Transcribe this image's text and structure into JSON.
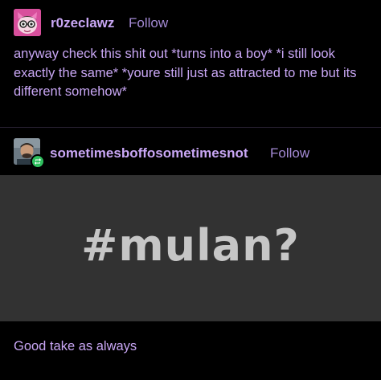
{
  "post1": {
    "username": "r0zeclawz",
    "follow_label": "Follow",
    "text": "anyway check this shit out *turns into a boy* *i still look exactly the same* *youre still just as attracted to me but its different somehow*"
  },
  "post2": {
    "username": "sometimesboffosometimesnot",
    "follow_label": "Follow",
    "image_text": "#mulan?",
    "caption": "Good take as always"
  },
  "colors": {
    "background": "#000000",
    "text_purple": "#c9a7f5",
    "follow_purple": "#a58bd6",
    "image_bg": "#323232",
    "image_text": "#c6c6c6",
    "reblog_green": "#2fbf5e"
  },
  "icons": {
    "post1_avatar": "cartoon-cat-avatar",
    "post2_avatar": "person-photo-avatar",
    "reblog_badge": "reblog-icon"
  }
}
